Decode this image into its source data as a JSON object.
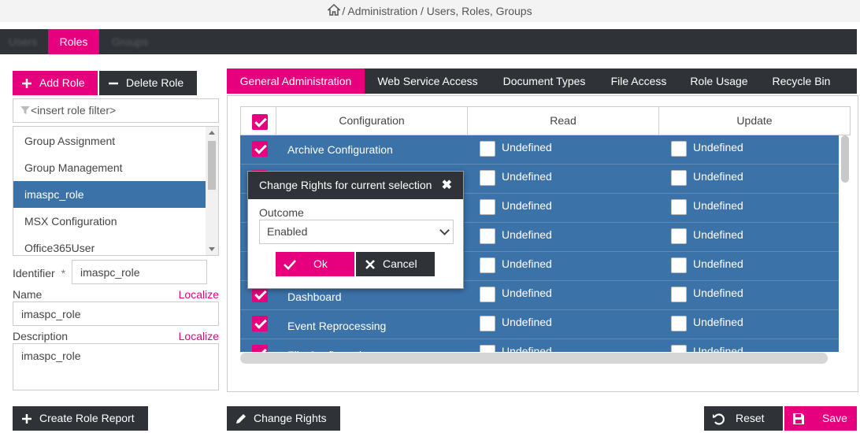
{
  "breadcrumb": {
    "text": "/ Administration / Users, Roles, Groups"
  },
  "top_tabs": [
    {
      "label": "Users"
    },
    {
      "label": "Roles"
    },
    {
      "label": "Groups"
    }
  ],
  "role_buttons": {
    "add": "Add Role",
    "delete": "Delete Role"
  },
  "role_filter": {
    "placeholder": "<insert role filter>"
  },
  "roles": [
    {
      "label": "Group Assignment"
    },
    {
      "label": "Group Management"
    },
    {
      "label": "imaspc_role"
    },
    {
      "label": "MSX Configuration"
    },
    {
      "label": "Office365User"
    }
  ],
  "form": {
    "identifier_label": "Identifier",
    "required_mark": "*",
    "identifier_value": "imaspc_role",
    "name_label": "Name",
    "name_value": "imaspc_role",
    "description_label": "Description",
    "description_value": "imaspc_role",
    "localize": "Localize"
  },
  "sub_tabs": [
    {
      "label": "General Administration"
    },
    {
      "label": "Web Service Access"
    },
    {
      "label": "Document Types"
    },
    {
      "label": "File Access"
    },
    {
      "label": "Role Usage"
    },
    {
      "label": "Recycle Bin"
    }
  ],
  "grid": {
    "columns": [
      "Configuration",
      "Read",
      "Update"
    ],
    "rows": [
      {
        "name": "Archive Configuration",
        "read": "Undefined",
        "update": "Undefined"
      },
      {
        "name": "",
        "read": "Undefined",
        "update": "Undefined"
      },
      {
        "name": "",
        "read": "Undefined",
        "update": "Undefined"
      },
      {
        "name": "",
        "read": "Undefined",
        "update": "Undefined"
      },
      {
        "name": "",
        "read": "Undefined",
        "update": "Undefined"
      },
      {
        "name": "Dashboard",
        "read": "Undefined",
        "update": "Undefined"
      },
      {
        "name": "Event Reprocessing",
        "read": "Undefined",
        "update": "Undefined"
      },
      {
        "name": "File Configuration",
        "read": "Undefined",
        "update": "Undefined"
      }
    ]
  },
  "dialog": {
    "title": "Change Rights for current selection",
    "outcome_label": "Outcome",
    "outcome_value": "Enabled",
    "ok": "Ok",
    "cancel": "Cancel"
  },
  "bottom": {
    "create_report": "Create Role Report",
    "change_rights": "Change Rights",
    "reset": "Reset",
    "save": "Save"
  },
  "colors": {
    "accent": "#e6007e",
    "dark": "#2f3237",
    "selection": "#3b72a8"
  }
}
